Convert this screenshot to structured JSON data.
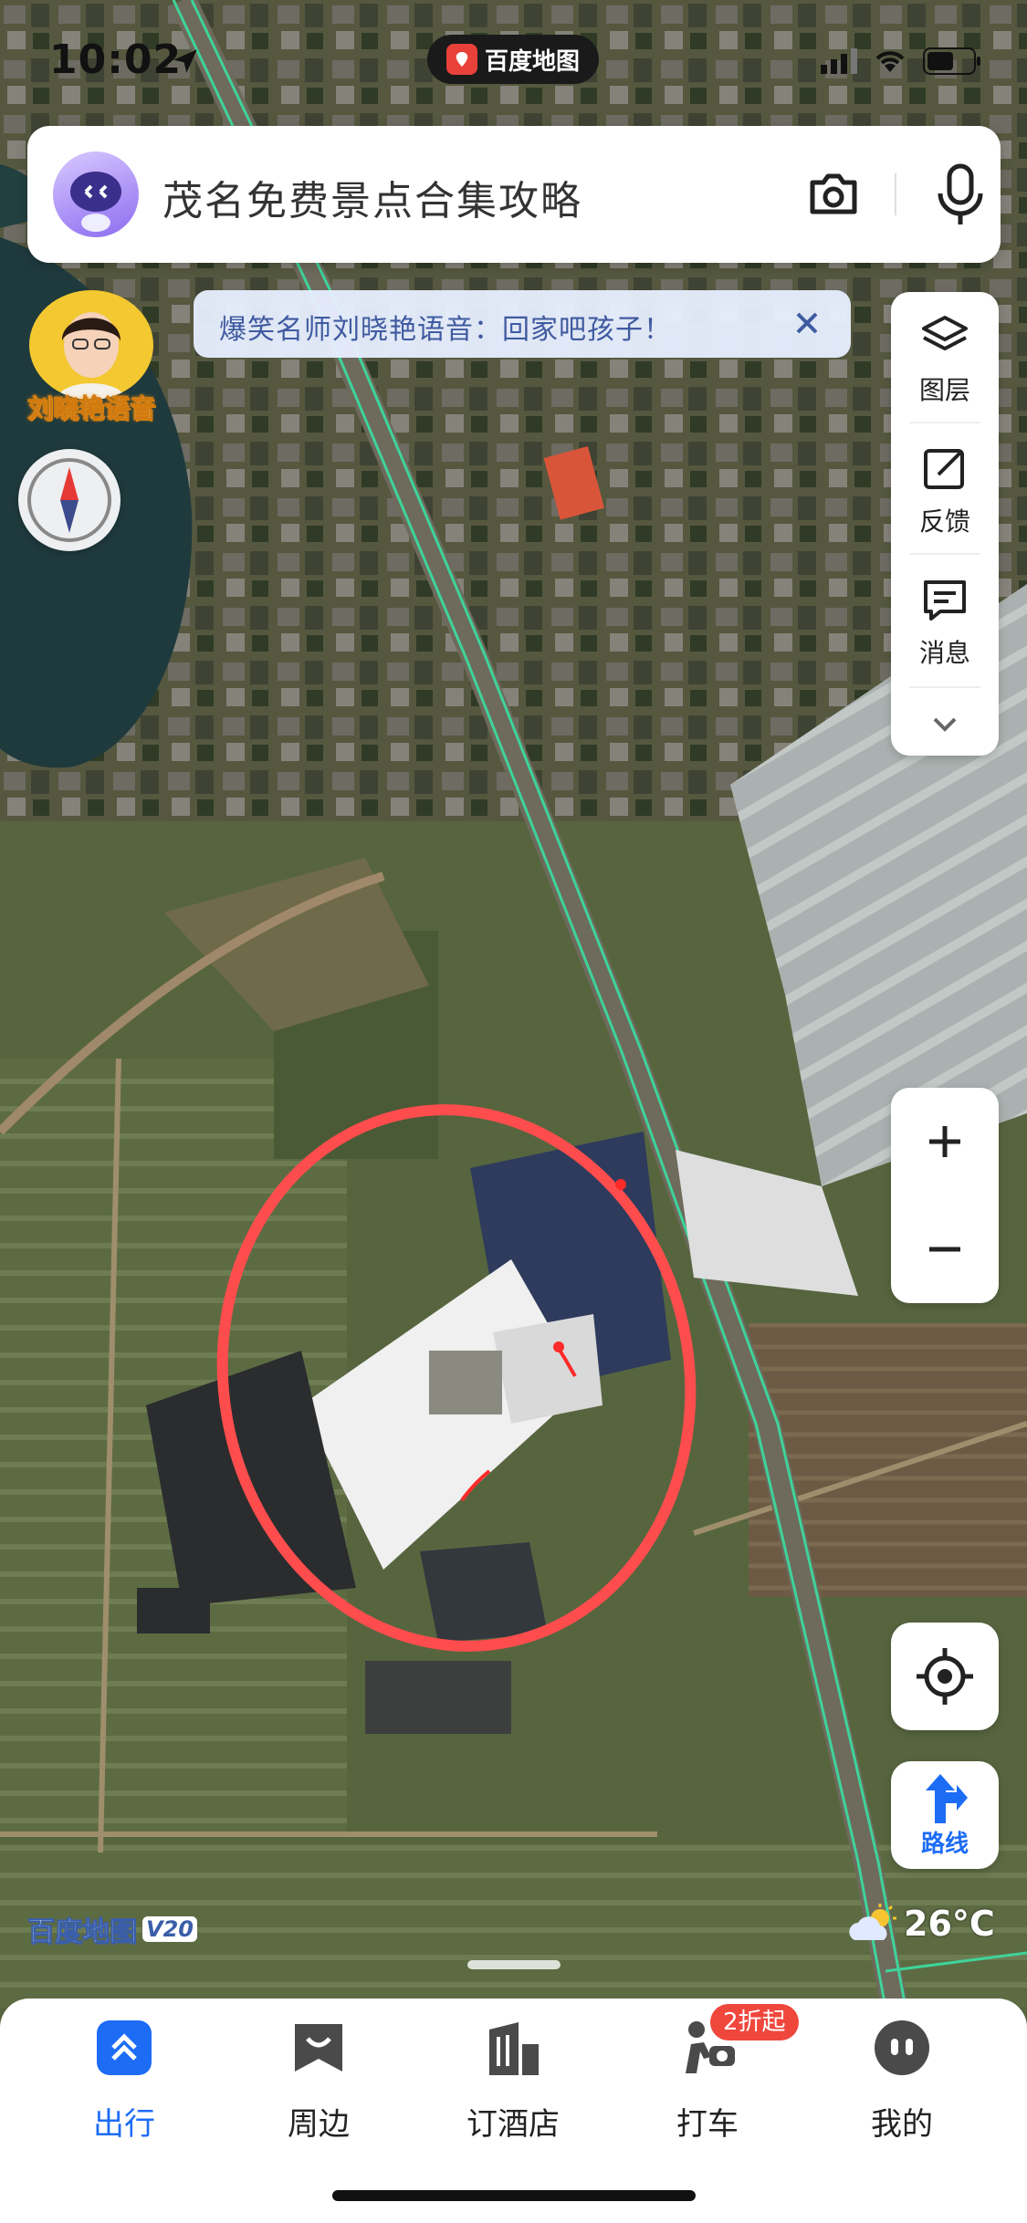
{
  "status_bar": {
    "time": "10:02",
    "app_name": "百度地图"
  },
  "search": {
    "text": "茂名免费景点合集攻略",
    "camera_icon": "camera-icon",
    "mic_icon": "microphone-icon"
  },
  "voice_banner": {
    "text": "爆笑名师刘晓艳语音：回家吧孩子！"
  },
  "voice_avatar": {
    "label": "刘晓艳语音"
  },
  "tools": {
    "layers": "图层",
    "feedback": "反馈",
    "messages": "消息"
  },
  "zoom": {
    "in": "+",
    "out": "−"
  },
  "route": {
    "label": "路线"
  },
  "watermark": {
    "name": "百度地图",
    "version": "V20"
  },
  "weather": {
    "temp": "26°C",
    "icon": "partly-cloudy-icon"
  },
  "nav": {
    "items": [
      {
        "label": "出行",
        "icon": "travel-icon",
        "active": true
      },
      {
        "label": "周边",
        "icon": "nearby-icon",
        "active": false
      },
      {
        "label": "订酒店",
        "icon": "hotel-icon",
        "active": false
      },
      {
        "label": "打车",
        "icon": "taxi-icon",
        "active": false
      },
      {
        "label": "我的",
        "icon": "profile-icon",
        "active": false
      }
    ],
    "taxi_badge": "2折起"
  },
  "colors": {
    "accent": "#1d6cf5",
    "badge": "#f0473d",
    "route_line": "#3fd39a",
    "annotation": "#ff4d4d"
  }
}
